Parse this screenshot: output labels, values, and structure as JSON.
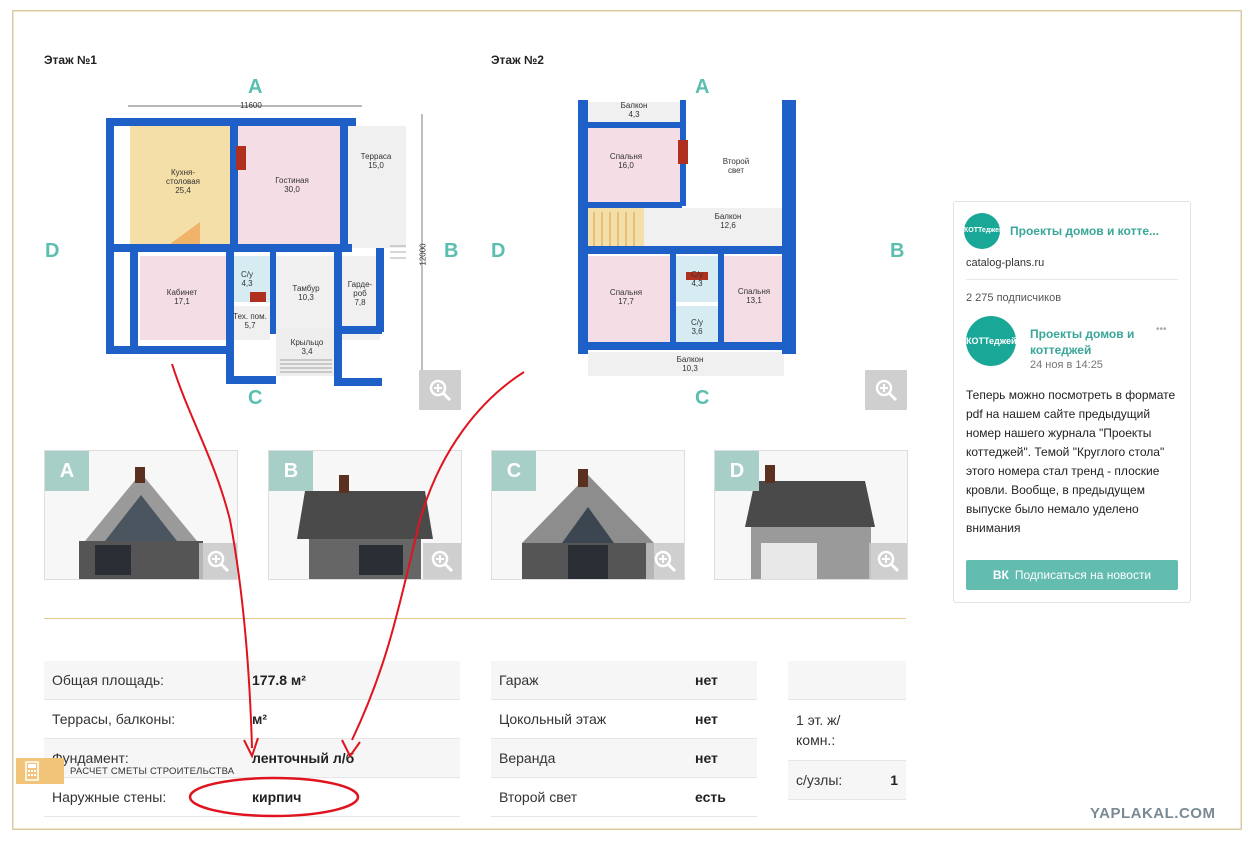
{
  "floor1": {
    "title": "Этаж №1",
    "dims": {
      "width": "11600",
      "height": "12000"
    },
    "compass": {
      "top": "A",
      "bottom": "C",
      "left": "D",
      "right": "B"
    },
    "rooms": [
      {
        "name": "Кухня-\nстоловая",
        "area": "25,4"
      },
      {
        "name": "Гостиная",
        "area": "30,0"
      },
      {
        "name": "Терраса",
        "area": "15,0"
      },
      {
        "name": "Кабинет",
        "area": "17,1"
      },
      {
        "name": "С/у",
        "area": "4,3"
      },
      {
        "name": "Тамбур",
        "area": "10,3"
      },
      {
        "name": "Гарде-\nроб",
        "area": "7,8"
      },
      {
        "name": "Тех. пом.",
        "area": "5,7"
      },
      {
        "name": "Крыльцо",
        "area": "3,4"
      }
    ]
  },
  "floor2": {
    "title": "Этаж №2",
    "compass": {
      "top": "A",
      "bottom": "C",
      "left": "D",
      "right": "B"
    },
    "rooms": [
      {
        "name": "Балкон",
        "area": "4,3"
      },
      {
        "name": "Спальня",
        "area": "16,0"
      },
      {
        "name": "Второй\nсвет",
        "area": ""
      },
      {
        "name": "Балкон",
        "area": "12,6"
      },
      {
        "name": "Спальня",
        "area": "17,7"
      },
      {
        "name": "С/у",
        "area": "4,3"
      },
      {
        "name": "С/у",
        "area": "3,6"
      },
      {
        "name": "Спальня",
        "area": "13,1"
      },
      {
        "name": "Балкон",
        "area": "10,3"
      }
    ]
  },
  "facades": [
    "A",
    "B",
    "C",
    "D"
  ],
  "specs": {
    "col1": [
      {
        "label": "Общая площадь:",
        "value": "177.8 м²"
      },
      {
        "label": "Террасы, балконы:",
        "value": "м²"
      },
      {
        "label": "Фундамент:",
        "value": "ленточный л/б"
      },
      {
        "label": "Наружные стены:",
        "value": "кирпич"
      }
    ],
    "col2": [
      {
        "label": "Гараж",
        "value": "нет"
      },
      {
        "label": "Цокольный этаж",
        "value": "нет"
      },
      {
        "label": "Веранда",
        "value": "нет"
      },
      {
        "label": "Второй свет",
        "value": "есть"
      }
    ],
    "col3": [
      {
        "label": "",
        "value": ""
      },
      {
        "label": "1 эт. ж/\nкомн.:",
        "value": ""
      },
      {
        "label": "с/узлы:",
        "value": "1"
      }
    ]
  },
  "calc_label": "РАСЧЕТ СМЕТЫ СТРОИТЕЛЬСТВА",
  "vk": {
    "group_title": "Проекты домов и котте...",
    "avatar_text": "КОТТеджей",
    "site": "catalog-plans.ru",
    "subscribers": "2 275 подписчиков",
    "post_author": "Проекты домов и\nкоттеджей",
    "post_time": "24 ноя в 14:25",
    "post_text": "Теперь можно посмотреть в формате pdf на нашем сайте предыдущий номер нашего журнала \"Проекты коттеджей\". Темой \"Круглого стола\" этого номера стал тренд - плоские кровли. Вообще, в предыдущем выпуске было немало уделено внимания",
    "subscribe_button": "Подписаться на новости",
    "more": "•••"
  },
  "watermark": "YAPLAKAL.COM",
  "watermark_text": "www.catalog-plans.ru",
  "colors": {
    "wall": "#1e5fc8",
    "teal": "#5bbfb0",
    "annotation": "#e0141e",
    "pink": "#f4dde4",
    "beige": "#f5dfa8"
  }
}
